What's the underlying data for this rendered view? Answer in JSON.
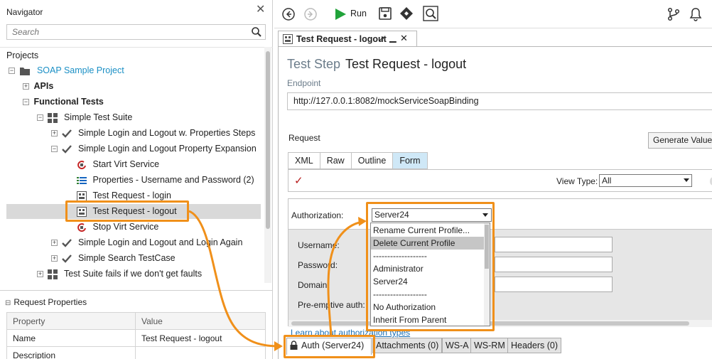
{
  "navigator": {
    "title": "Navigator",
    "close_glyph": "✕",
    "search_placeholder": "Search",
    "projects_label": "Projects",
    "tree": [
      {
        "label": "SOAP Sample Project",
        "expander": "−",
        "icon": "folder-icon"
      },
      {
        "label": "APIs",
        "expander": "+",
        "icon": ""
      },
      {
        "label": "Functional Tests",
        "expander": "−",
        "icon": ""
      },
      {
        "label": "Simple Test Suite",
        "expander": "−",
        "icon": "test-suite-icon"
      },
      {
        "label": "Simple Login and Logout w. Properties Steps",
        "expander": "+",
        "icon": "checkmark-icon"
      },
      {
        "label": "Simple Login and Logout Property Expansion",
        "expander": "−",
        "icon": "checkmark-icon"
      },
      {
        "label": "Start Virt Service",
        "expander": "",
        "icon": "start-virt-icon"
      },
      {
        "label": "Properties - Username and Password (2)",
        "expander": "",
        "icon": "properties-icon"
      },
      {
        "label": "Test Request - login",
        "expander": "",
        "icon": "soap-request-icon"
      },
      {
        "label": "Test Request - logout",
        "expander": "",
        "icon": "soap-request-icon"
      },
      {
        "label": "Stop Virt Service",
        "expander": "",
        "icon": "stop-virt-icon"
      },
      {
        "label": "Simple Login and Logout and Login Again",
        "expander": "+",
        "icon": "checkmark-icon"
      },
      {
        "label": "Simple Search TestCase",
        "expander": "+",
        "icon": "checkmark-icon"
      },
      {
        "label": "Test Suite fails if we don't get faults",
        "expander": "+",
        "icon": "test-suite-icon"
      }
    ],
    "selected_index": 9
  },
  "request_properties": {
    "title": "Request Properties",
    "collapse_glyph": "⊟",
    "col_property": "Property",
    "col_value": "Value",
    "rows": [
      {
        "property": "Name",
        "value": "Test Request - logout"
      },
      {
        "property": "Description",
        "value": ""
      }
    ]
  },
  "toolbar": {
    "run_label": "Run",
    "icons": [
      "back-icon",
      "forward-icon",
      "run-icon",
      "save-icon",
      "api-icon",
      "search-icon",
      "branch-icon",
      "notifications-icon"
    ]
  },
  "editor_tab": {
    "label": "Test Request - logout",
    "pin_glyph": "↗",
    "minimize_glyph": "▁",
    "close_glyph": "✕"
  },
  "editor": {
    "step_prefix": "Test Step",
    "step_title": "Test Request - logout",
    "endpoint_label": "Endpoint",
    "endpoint_value": "http://127.0.0.1:8082/mockServiceSoapBinding",
    "request_label": "Request",
    "generate_button": "Generate Values",
    "tabs": [
      "XML",
      "Raw",
      "Outline",
      "Form"
    ],
    "active_tab": "Form",
    "check_glyph": "✓",
    "view_type_label": "View Type:",
    "view_type_value": "All",
    "authorization_label": "Authorization:",
    "authorization_value": "Server24",
    "credential_labels": [
      "Username:",
      "Password:",
      "Domain:",
      "Pre-emptive auth:"
    ],
    "learn_link": "Learn about authorization types"
  },
  "auth_dropdown": {
    "items": [
      "Rename Current Profile...",
      "Delete Current Profile",
      "-------------------",
      "Administrator",
      "Server24",
      "-------------------",
      "No Authorization",
      "Inherit From Parent"
    ],
    "highlighted_index": 1
  },
  "bottom_tabs": {
    "auth": "Auth (Server24)",
    "attachments": "Attachments (0)",
    "wsa": "WS-A",
    "wsrm": "WS-RM",
    "headers": "Headers (0)"
  },
  "colors": {
    "highlight": "#f0901a",
    "link": "#1a6fb5",
    "project": "#1a8fc5",
    "active_tab": "#cfe8f7",
    "run": "#21a33a"
  }
}
